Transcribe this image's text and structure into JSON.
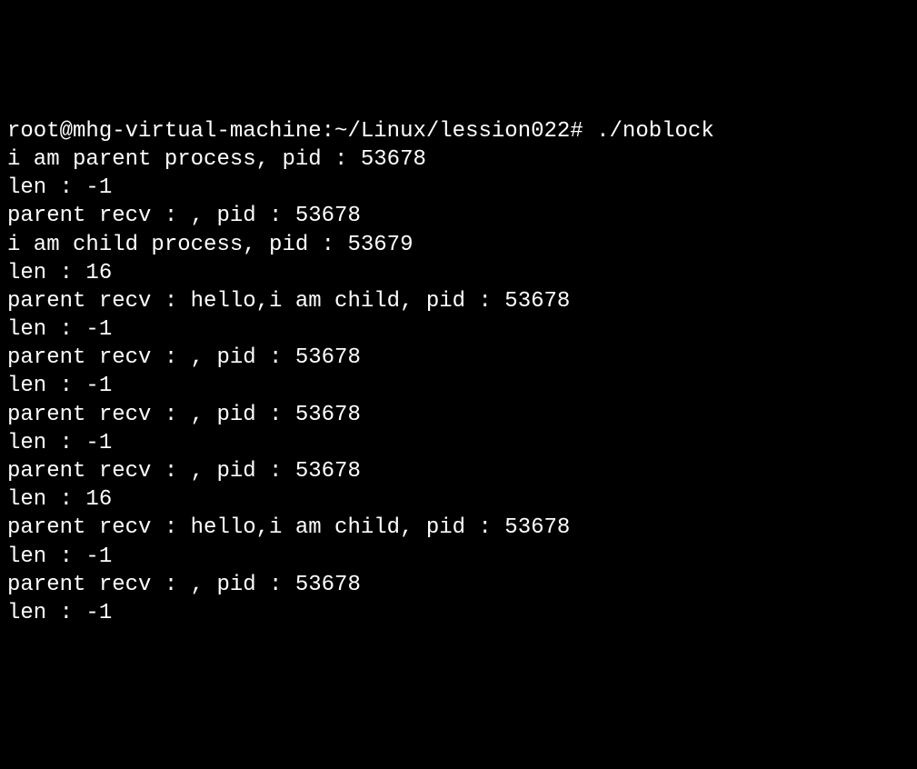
{
  "terminal": {
    "lines": [
      "root@mhg-virtual-machine:~/Linux/lession022# ./noblock",
      "i am parent process, pid : 53678",
      "len : -1",
      "parent recv : , pid : 53678",
      "i am child process, pid : 53679",
      "len : 16",
      "parent recv : hello,i am child, pid : 53678",
      "len : -1",
      "parent recv : , pid : 53678",
      "len : -1",
      "parent recv : , pid : 53678",
      "len : -1",
      "parent recv : , pid : 53678",
      "len : 16",
      "parent recv : hello,i am child, pid : 53678",
      "len : -1",
      "parent recv : , pid : 53678",
      "len : -1"
    ]
  }
}
